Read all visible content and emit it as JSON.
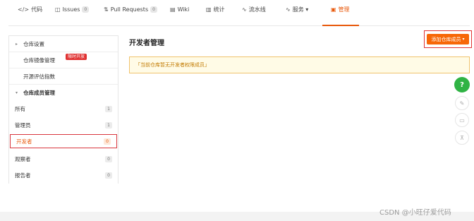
{
  "tabs": [
    {
      "icon": "code-icon",
      "glyph": "</>",
      "label": "代码"
    },
    {
      "icon": "issues-icon",
      "glyph": "◫",
      "label": "Issues",
      "count": "0"
    },
    {
      "icon": "pull-request-icon",
      "glyph": "⇅",
      "label": "Pull Requests",
      "count": "0"
    },
    {
      "icon": "wiki-icon",
      "glyph": "▤",
      "label": "Wiki"
    },
    {
      "icon": "stats-icon",
      "glyph": "▥",
      "label": "统计"
    },
    {
      "icon": "pipeline-icon",
      "glyph": "∿",
      "label": "流水线"
    },
    {
      "icon": "services-icon",
      "glyph": "∿",
      "label": "服务 ▾"
    },
    {
      "icon": "manage-icon",
      "glyph": "▣",
      "label": "管理"
    }
  ],
  "sidebar": {
    "repo_settings": "仓库设置",
    "repo_mirror": "仓库镜像管理",
    "limited_badge": "限时开放",
    "oss_index": "开源评估指数",
    "members_group": "仓库成员管理",
    "members": [
      {
        "label": "所有",
        "count": "1"
      },
      {
        "label": "管理员",
        "count": "1"
      },
      {
        "label": "开发者",
        "count": "0"
      },
      {
        "label": "观察者",
        "count": "0"
      },
      {
        "label": "报告者",
        "count": "0"
      }
    ]
  },
  "main": {
    "title": "开发者管理",
    "add_button": "添加仓库成员",
    "notice": "「当前仓库暂无开发者权限成员」"
  },
  "floating": {
    "help": "?",
    "edit_glyph": "✎",
    "message_glyph": "▭",
    "top_glyph": "⊼"
  },
  "watermark": "CSDN @小旺仔爱代码",
  "colors": {
    "accent": "#e8590c",
    "button": "#f76707",
    "highlight_border": "#e03131",
    "help": "#2fb344"
  }
}
